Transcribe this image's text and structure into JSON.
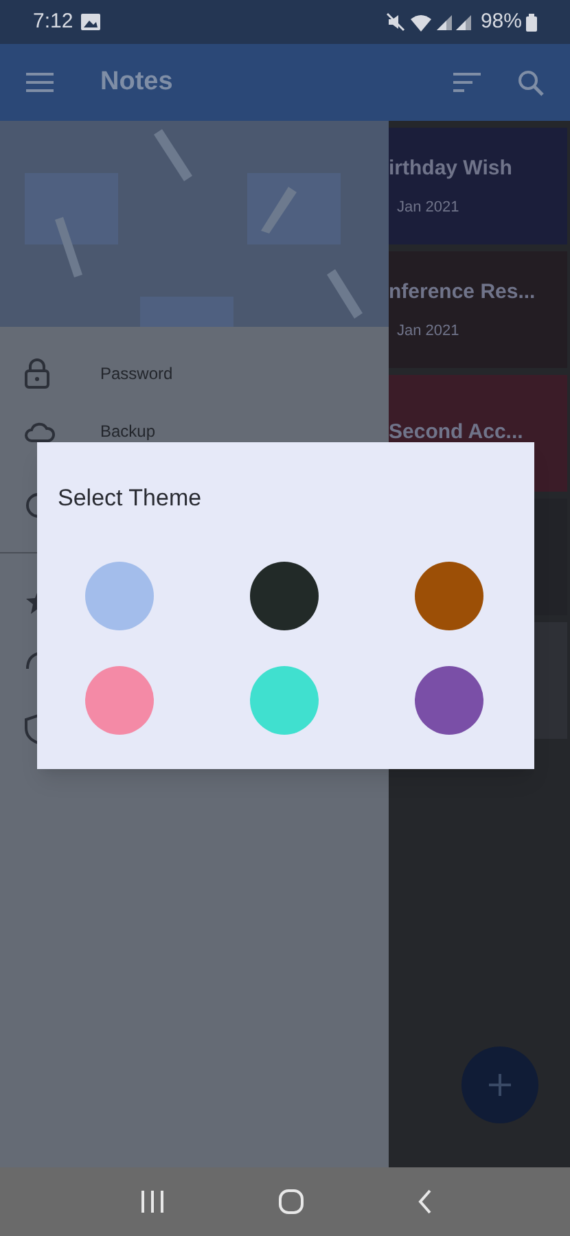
{
  "status_bar": {
    "time": "7:12",
    "battery": "98%"
  },
  "app_bar": {
    "title": "Notes"
  },
  "drawer": {
    "items": [
      {
        "label": "Password"
      },
      {
        "label": "Backup"
      }
    ]
  },
  "notes": [
    {
      "title": "irthday Wish",
      "date": "Jan 2021",
      "color": "#1b1e3a"
    },
    {
      "title": "nference Res...",
      "date": "Jan 2021",
      "color": "#231d23"
    },
    {
      "title": "Second Acc...",
      "color": "#3b1c28"
    },
    {
      "color": "#222328"
    },
    {
      "color": "#2e3036"
    }
  ],
  "dialog": {
    "title": "Select Theme",
    "themes": [
      {
        "color": "#a3bdeb"
      },
      {
        "color": "#222a28"
      },
      {
        "color": "#9c4f06"
      },
      {
        "color": "#f48aa6"
      },
      {
        "color": "#40e0cf"
      },
      {
        "color": "#7a4fa7"
      }
    ]
  }
}
